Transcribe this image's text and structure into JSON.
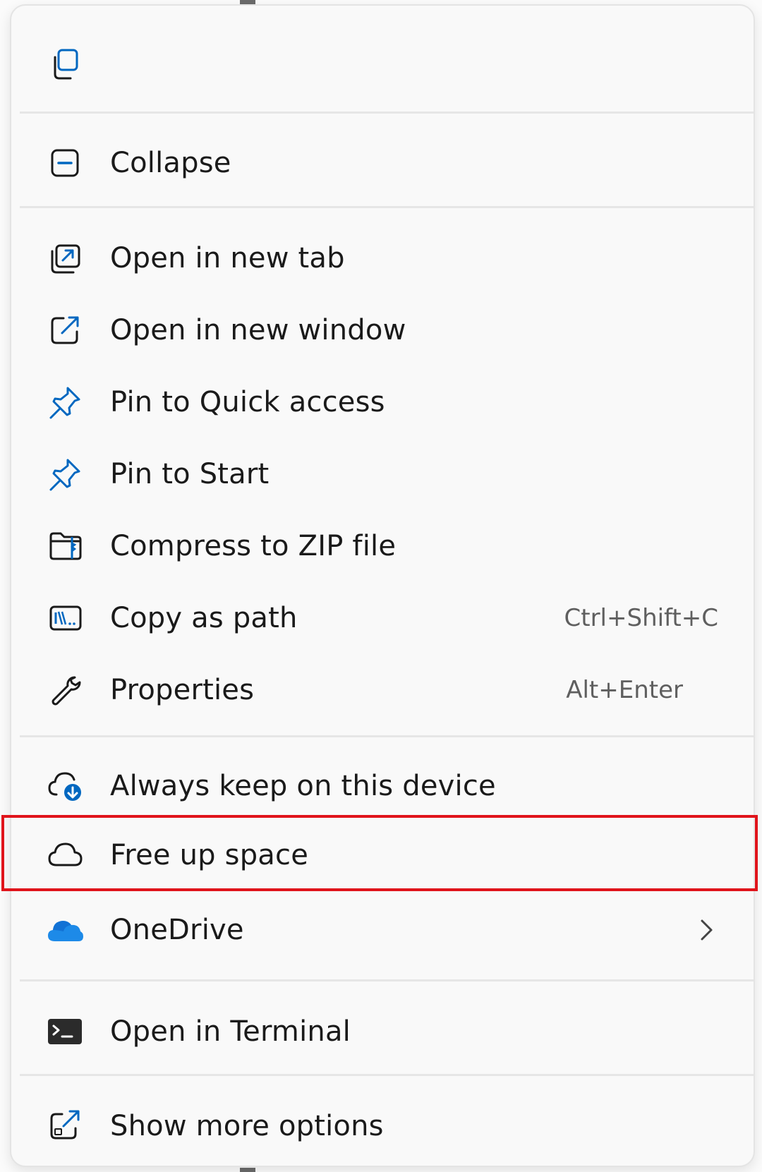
{
  "context_menu": {
    "top_action": {
      "icon": "copy-icon"
    },
    "items": [
      {
        "id": "collapse",
        "label": "Collapse",
        "icon": "collapse-icon"
      },
      {
        "id": "open-new-tab",
        "label": "Open in new tab",
        "icon": "open-new-tab-icon"
      },
      {
        "id": "open-new-window",
        "label": "Open in new window",
        "icon": "open-new-window-icon"
      },
      {
        "id": "pin-quick-access",
        "label": "Pin to Quick access",
        "icon": "pin-icon"
      },
      {
        "id": "pin-start",
        "label": "Pin to Start",
        "icon": "pin-icon"
      },
      {
        "id": "compress-zip",
        "label": "Compress to ZIP file",
        "icon": "zip-folder-icon"
      },
      {
        "id": "copy-as-path",
        "label": "Copy as path",
        "shortcut": "Ctrl+Shift+C",
        "icon": "copy-path-icon"
      },
      {
        "id": "properties",
        "label": "Properties",
        "shortcut": "Alt+Enter",
        "icon": "wrench-icon"
      },
      {
        "id": "always-keep",
        "label": "Always keep on this device",
        "icon": "cloud-download-icon"
      },
      {
        "id": "free-up-space",
        "label": "Free up space",
        "icon": "cloud-outline-icon",
        "highlighted": true
      },
      {
        "id": "onedrive",
        "label": "OneDrive",
        "icon": "onedrive-icon",
        "has_submenu": true
      },
      {
        "id": "open-terminal",
        "label": "Open in Terminal",
        "icon": "terminal-icon"
      },
      {
        "id": "show-more",
        "label": "Show more options",
        "icon": "show-more-icon"
      }
    ]
  },
  "colors": {
    "accent_blue": "#0067c0",
    "onedrive_blue": "#1d8ae8",
    "highlight_red": "#e0141b",
    "text": "#1a1a1a",
    "shortcut_text": "#5f5f5f"
  }
}
